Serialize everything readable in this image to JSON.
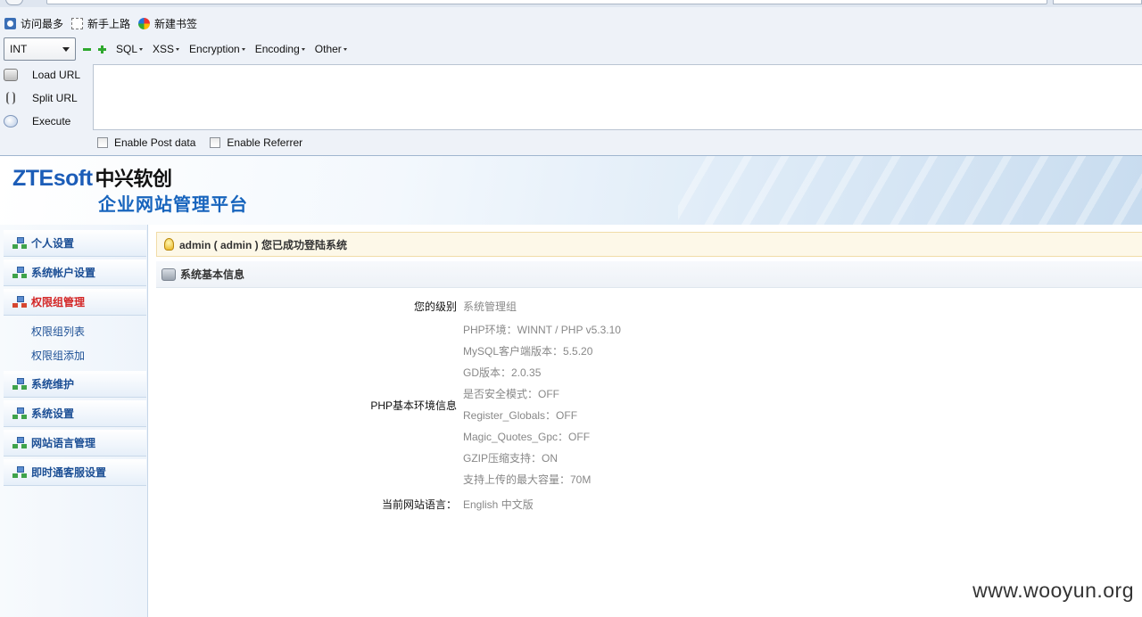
{
  "browser": {
    "bookmarks": [
      {
        "label": "访问最多",
        "icon": "most-visited-icon"
      },
      {
        "label": "新手上路",
        "icon": "newbie-icon"
      },
      {
        "label": "新建书签",
        "icon": "new-bookmark-icon"
      }
    ]
  },
  "hackbar": {
    "select_value": "INT",
    "menus": [
      "SQL",
      "XSS",
      "Encryption",
      "Encoding",
      "Other"
    ],
    "buttons": {
      "load_url": "Load URL",
      "split_url": "Split URL",
      "execute": "Execute"
    },
    "url_value": "",
    "checkboxes": {
      "post": "Enable Post data",
      "referrer": "Enable Referrer"
    }
  },
  "site": {
    "logo_latin": "ZTEsoft",
    "logo_cn": "中兴软创",
    "platform_title": "企业网站管理平台",
    "nav": [
      {
        "label": "个人设置"
      },
      {
        "label": "系统帐户设置"
      },
      {
        "label": "权限组管理",
        "active": true,
        "sub": [
          "权限组列表",
          "权限组添加"
        ]
      },
      {
        "label": "系统维护"
      },
      {
        "label": "系统设置"
      },
      {
        "label": "网站语言管理"
      },
      {
        "label": "即时通客服设置"
      }
    ],
    "alert": "admin ( admin ) 您已成功登陆系统",
    "section_title": "系统基本信息",
    "info": {
      "level_label": "您的级别",
      "level_value": "系统管理组",
      "php_label": "PHP基本环境信息",
      "php_values": [
        "PHP环境：WINNT / PHP v5.3.10",
        "MySQL客户端版本：5.5.20",
        "GD版本：2.0.35",
        "是否安全模式：OFF",
        "Register_Globals：OFF",
        "Magic_Quotes_Gpc：OFF",
        "GZIP压缩支持：ON",
        "支持上传的最大容量：70M"
      ],
      "lang_label": "当前网站语言：",
      "lang_value": "English 中文版"
    }
  },
  "watermark": "www.wooyun.org"
}
